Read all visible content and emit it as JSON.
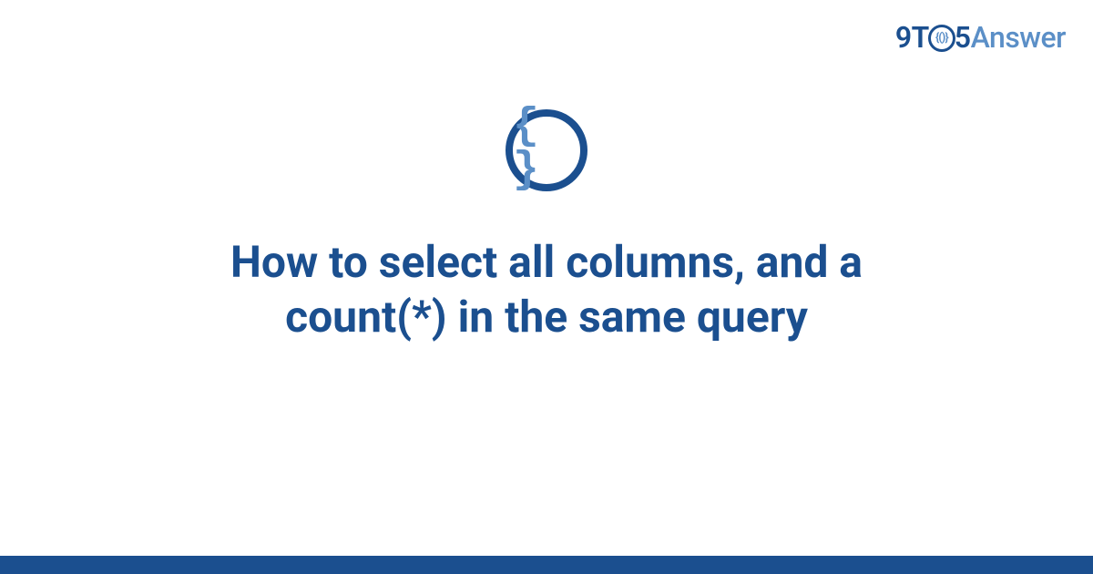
{
  "logo": {
    "nine": "9",
    "t": "T",
    "o_inner": "{()}",
    "five": "5",
    "answer": "Answer"
  },
  "icon": {
    "braces": "{ }",
    "name": "code-braces-icon"
  },
  "title": "How to select all columns, and a count(*) in the same query",
  "colors": {
    "primary": "#1b4f8f",
    "accent": "#5b8fc7"
  }
}
